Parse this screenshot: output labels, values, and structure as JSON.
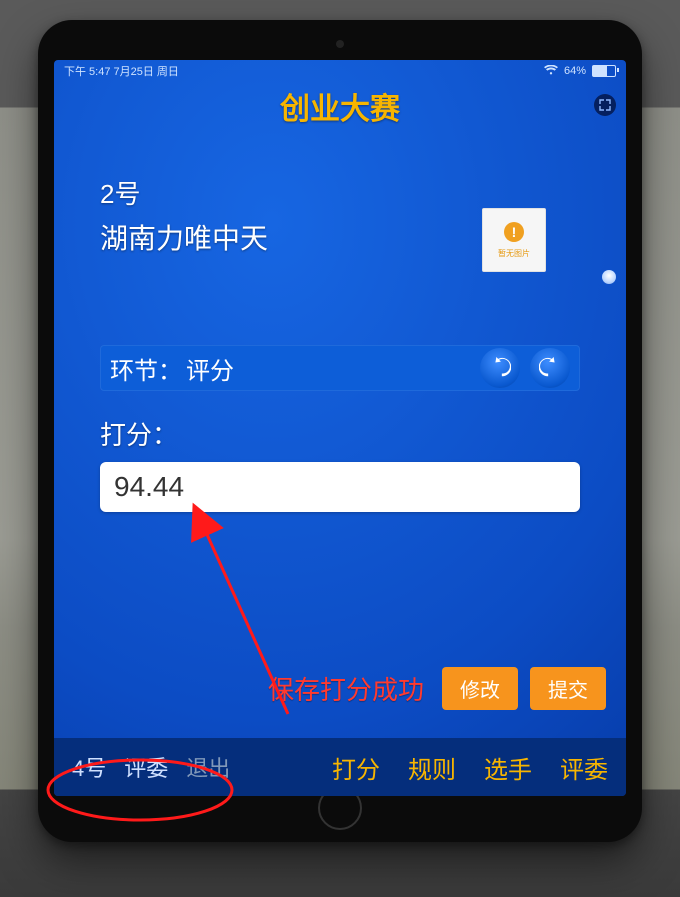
{
  "status_bar": {
    "time": "下午 5:47  7月25日 周日",
    "battery": "64%"
  },
  "title": "创业大赛",
  "fullscreen_icon": "⤡",
  "contestant": {
    "number": "2号",
    "name": "湖南力唯中天",
    "thumbnail_caption": "暂无图片"
  },
  "stage": {
    "label": "环节：",
    "value": "评分"
  },
  "score": {
    "label": "打分：",
    "value": "94.44"
  },
  "toast": "保存打分成功",
  "buttons": {
    "modify": "修改",
    "submit": "提交"
  },
  "footer": {
    "judge_no": "4号",
    "judge_role": "评委",
    "exit": "退出",
    "tabs": {
      "score": "打分",
      "rules": "规则",
      "contestants": "选手",
      "judges": "评委"
    }
  }
}
